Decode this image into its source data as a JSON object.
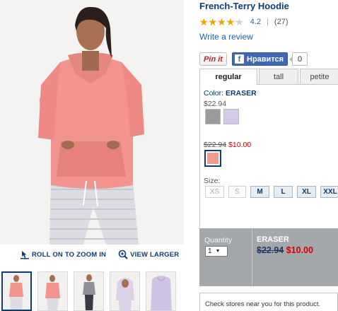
{
  "product": {
    "title": "French-Terry Hoodie",
    "rating": {
      "value": "4.2",
      "stars_fraction": 0.84,
      "separator": "|",
      "count": "(27)"
    },
    "write_review": "Write a review"
  },
  "social": {
    "pinterest_label": "Pin it",
    "facebook_label": "Нравится",
    "facebook_icon": "f",
    "facebook_count": "0"
  },
  "tabs": [
    {
      "label": "regular",
      "active": true
    },
    {
      "label": "tall",
      "active": false
    },
    {
      "label": "petite",
      "active": false
    }
  ],
  "color": {
    "label_prefix": "Color: ",
    "selected_name": "ERASER",
    "regular_price": "$22.94",
    "regular_swatches": [
      "#9a9a9a",
      "#d4c9e6"
    ],
    "sale_price_was": "$22.94",
    "sale_price_now": "$10.00",
    "sale_swatch": "#f29a92"
  },
  "sizes": {
    "label": "Size:",
    "options": [
      {
        "label": "XS",
        "available": false
      },
      {
        "label": "S",
        "available": false
      },
      {
        "label": "M",
        "available": true
      },
      {
        "label": "L",
        "available": true
      },
      {
        "label": "XL",
        "available": true
      },
      {
        "label": "XXL",
        "available": true
      }
    ]
  },
  "cart": {
    "quantity_label": "Quantity",
    "quantity_value": "1",
    "color_name": "ERASER",
    "price_was": "$22.94",
    "price_now": "$10.00"
  },
  "stores": {
    "label": "Check stores near you for this product."
  },
  "zoom": {
    "roll_on": "ROLL ON TO ZOOM IN",
    "view_larger": "VIEW LARGER"
  },
  "colors": {
    "brand_blue": "#0d3d6e",
    "link_blue": "#2266aa",
    "sale_red": "#cc0000",
    "star_gold": "#f0a400",
    "cart_gray": "#a4a8ab"
  }
}
